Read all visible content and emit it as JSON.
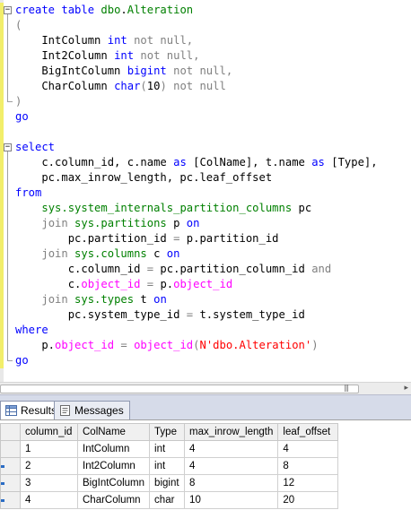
{
  "editor": {
    "lines": [
      {
        "fold": "−",
        "segs": [
          [
            "kw",
            "create table "
          ],
          [
            "tb",
            "dbo"
          ],
          [
            "",
            "."
          ],
          [
            "tb",
            "Alteration"
          ]
        ]
      },
      {
        "segs": [
          [
            "gr",
            "("
          ]
        ]
      },
      {
        "segs": [
          [
            "",
            "    IntColumn "
          ],
          [
            "kw",
            "int"
          ],
          [
            "gr",
            " not null,"
          ]
        ]
      },
      {
        "segs": [
          [
            "",
            "    Int2Column "
          ],
          [
            "kw",
            "int"
          ],
          [
            "gr",
            " not null,"
          ]
        ]
      },
      {
        "segs": [
          [
            "",
            "    BigIntColumn "
          ],
          [
            "kw",
            "bigint"
          ],
          [
            "gr",
            " not null,"
          ]
        ]
      },
      {
        "segs": [
          [
            "",
            "    CharColumn "
          ],
          [
            "kw",
            "char"
          ],
          [
            "gr",
            "("
          ],
          [
            "",
            "10"
          ],
          [
            "gr",
            ") not null"
          ]
        ]
      },
      {
        "segs": [
          [
            "gr",
            ")"
          ]
        ]
      },
      {
        "segs": [
          [
            "kw",
            "go"
          ]
        ]
      },
      {
        "segs": []
      },
      {
        "fold": "−",
        "segs": [
          [
            "kw",
            "select"
          ]
        ]
      },
      {
        "segs": [
          [
            "",
            "    c.column_id, c.name "
          ],
          [
            "kw",
            "as"
          ],
          [
            "",
            ""
          ],
          [
            "gr",
            " "
          ],
          [
            "",
            "[ColName], t.name "
          ],
          [
            "kw",
            "as"
          ],
          [
            "gr",
            " "
          ],
          [
            "",
            "[Type],"
          ]
        ]
      },
      {
        "segs": [
          [
            "",
            "    pc.max_inrow_length, pc.leaf_offset"
          ]
        ]
      },
      {
        "segs": [
          [
            "kw",
            "from"
          ]
        ]
      },
      {
        "segs": [
          [
            "",
            "    "
          ],
          [
            "tb",
            "sys.system_internals_partition_columns"
          ],
          [
            "",
            " pc"
          ]
        ]
      },
      {
        "segs": [
          [
            "",
            "    "
          ],
          [
            "gr",
            "join "
          ],
          [
            "tb",
            "sys.partitions"
          ],
          [
            "",
            " p "
          ],
          [
            "kw",
            "on"
          ]
        ]
      },
      {
        "segs": [
          [
            "",
            "        pc.partition_id "
          ],
          [
            "gr",
            "="
          ],
          [
            "",
            " p.partition_id"
          ]
        ]
      },
      {
        "segs": [
          [
            "",
            "    "
          ],
          [
            "gr",
            "join "
          ],
          [
            "tb",
            "sys.columns"
          ],
          [
            "",
            " c "
          ],
          [
            "kw",
            "on"
          ]
        ]
      },
      {
        "segs": [
          [
            "",
            "        c.column_id "
          ],
          [
            "gr",
            "="
          ],
          [
            "",
            " pc.partition_column_id "
          ],
          [
            "gr",
            "and"
          ]
        ]
      },
      {
        "segs": [
          [
            "",
            "        c."
          ],
          [
            "fn",
            "object_id"
          ],
          [
            "gr",
            " = "
          ],
          [
            "",
            "p."
          ],
          [
            "fn",
            "object_id"
          ]
        ]
      },
      {
        "segs": [
          [
            "",
            "    "
          ],
          [
            "gr",
            "join "
          ],
          [
            "tb",
            "sys.types"
          ],
          [
            "",
            " t "
          ],
          [
            "kw",
            "on"
          ]
        ]
      },
      {
        "segs": [
          [
            "",
            "        pc.system_type_id "
          ],
          [
            "gr",
            "="
          ],
          [
            "",
            " t.system_type_id"
          ]
        ]
      },
      {
        "segs": [
          [
            "kw",
            "where"
          ]
        ]
      },
      {
        "segs": [
          [
            "",
            "    p."
          ],
          [
            "fn",
            "object_id"
          ],
          [
            "gr",
            " = "
          ],
          [
            "fn",
            "object_id"
          ],
          [
            "gr",
            "("
          ],
          [
            "st",
            "N'dbo.Alteration'"
          ],
          [
            "gr",
            ")"
          ]
        ]
      },
      {
        "segs": [
          [
            "kw",
            "go"
          ]
        ]
      }
    ]
  },
  "results_tabs": {
    "results_label": "Results",
    "messages_label": "Messages"
  },
  "grid": {
    "columns": [
      "column_id",
      "ColName",
      "Type",
      "max_inrow_length",
      "leaf_offset"
    ],
    "rows": [
      [
        "1",
        "IntColumn",
        "int",
        "4",
        "4"
      ],
      [
        "2",
        "Int2Column",
        "int",
        "4",
        "8"
      ],
      [
        "3",
        "BigIntColumn",
        "bigint",
        "8",
        "12"
      ],
      [
        "4",
        "CharColumn",
        "char",
        "10",
        "20"
      ]
    ]
  },
  "colors": {
    "keyword": "#0000ff",
    "operator": "#808080",
    "function": "#ff00ff",
    "object": "#008000",
    "string": "#ff0000",
    "change_marker": "#f2ee6a"
  }
}
